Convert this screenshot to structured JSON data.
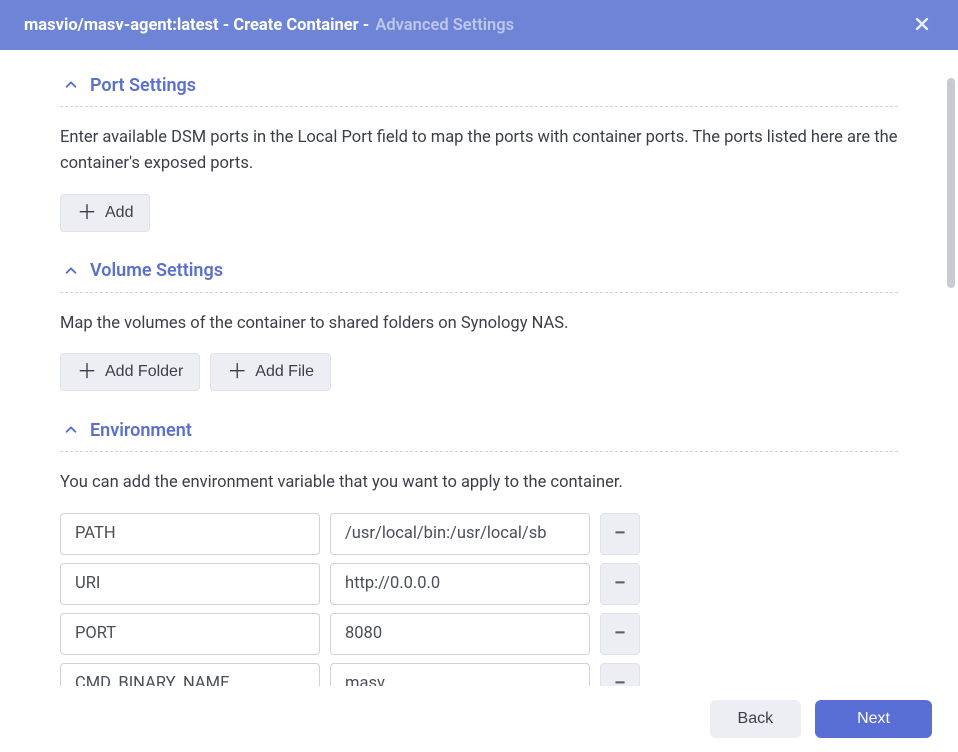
{
  "titlebar": {
    "image_tag": "masvio/masv-agent:latest",
    "action": "Create Container",
    "subtitle": "Advanced Settings"
  },
  "sections": {
    "port": {
      "title": "Port Settings",
      "description": "Enter available DSM ports in the Local Port field to map the ports with container ports. The ports listed here are the container's exposed ports.",
      "add_label": "Add"
    },
    "volume": {
      "title": "Volume Settings",
      "description": "Map the volumes of the container to shared folders on Synology NAS.",
      "add_folder_label": "Add Folder",
      "add_file_label": "Add File"
    },
    "env": {
      "title": "Environment",
      "description": "You can add the environment variable that you want to apply to the container.",
      "rows": [
        {
          "key": "PATH",
          "value": "/usr/local/bin:/usr/local/sb"
        },
        {
          "key": "URI",
          "value": "http://0.0.0.0"
        },
        {
          "key": "PORT",
          "value": "8080"
        },
        {
          "key": "CMD_BINARY_NAME",
          "value": "masv"
        }
      ]
    }
  },
  "footer": {
    "back": "Back",
    "next": "Next"
  }
}
